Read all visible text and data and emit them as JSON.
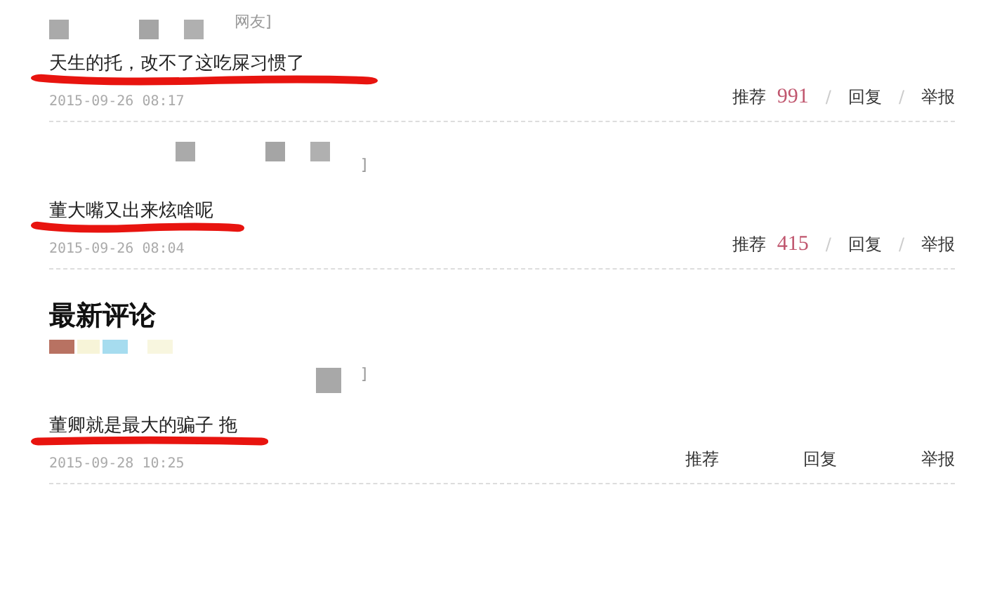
{
  "hot_comments": [
    {
      "name_fragment": "网友]",
      "text": "天生的托，改不了这吃屎习惯了",
      "time": "2015-09-26 08:17",
      "vote_label": "推荐",
      "vote_count": "991",
      "separator": "/",
      "reply": "回复",
      "report": "举报",
      "underlined": true
    },
    {
      "name_fragment": "]",
      "text": "董大嘴又出来炫啥呢",
      "time": "2015-09-26 08:04",
      "vote_label": "推荐",
      "vote_count": "415",
      "separator": "/",
      "reply": "回复",
      "report": "举报",
      "underlined": true
    }
  ],
  "latest_heading": "最新评论",
  "latest_comments": [
    {
      "name_fragment": "]",
      "text": "董卿就是最大的骗子 拖",
      "time": "2015-09-28 10:25",
      "vote_label": "推荐",
      "reply": "回复",
      "report": "举报",
      "underlined": true
    }
  ]
}
